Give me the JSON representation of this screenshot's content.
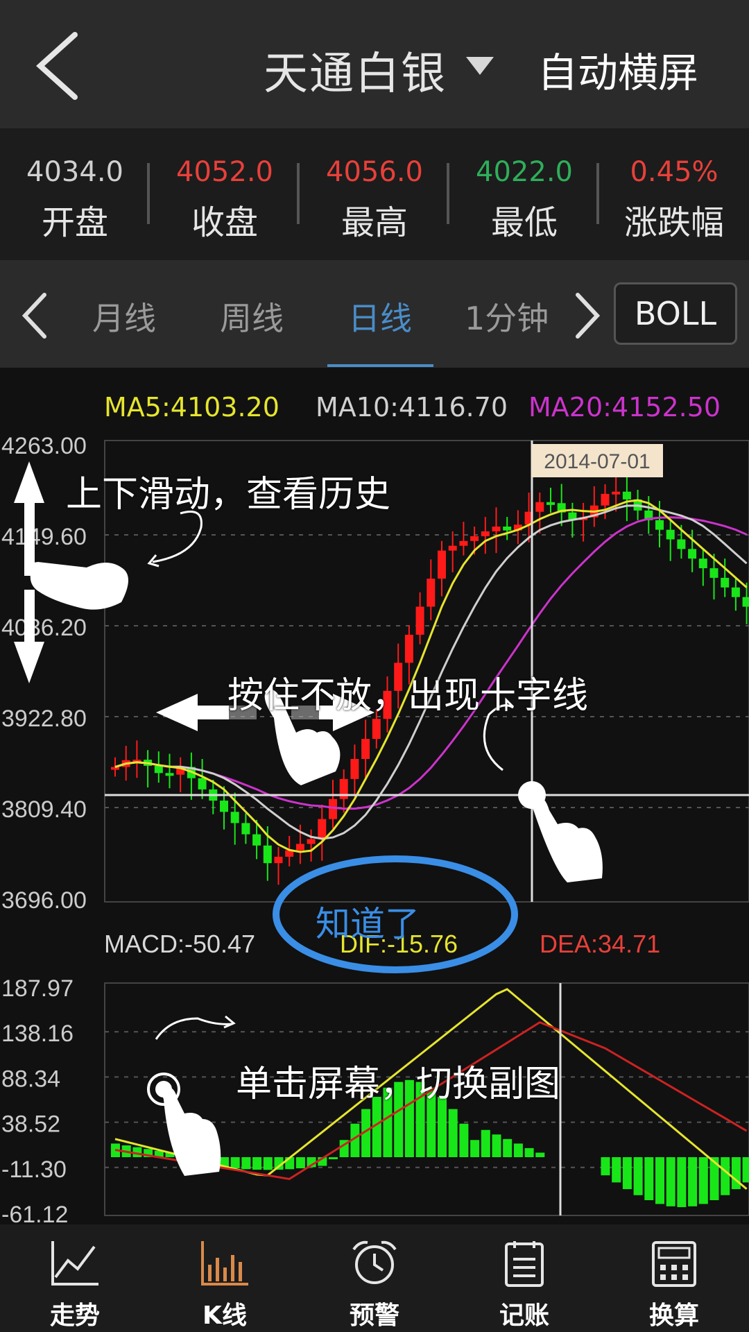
{
  "header": {
    "title": "天通白银",
    "auto_rotate": "自动横屏"
  },
  "stats": [
    {
      "value": "4034.0",
      "label": "开盘",
      "color": "#d0d0d0"
    },
    {
      "value": "4052.0",
      "label": "收盘",
      "color": "#e8403a"
    },
    {
      "value": "4056.0",
      "label": "最高",
      "color": "#e8403a"
    },
    {
      "value": "4022.0",
      "label": "最低",
      "color": "#2fae5a"
    },
    {
      "value": "0.45%",
      "label": "涨跌幅",
      "color": "#e8403a"
    }
  ],
  "periods": {
    "tabs": [
      "月线",
      "周线",
      "日线",
      "1分钟"
    ],
    "active": "日线",
    "indicator": "BOLL"
  },
  "ma_legend": {
    "ma5": "MA5:4103.20",
    "ma10": "MA10:4116.70",
    "ma20": "MA20:4152.50"
  },
  "crosshair_date": "2014-07-01",
  "macd_legend": {
    "macd": "MACD:-50.47",
    "dif": "DIF:-15.76",
    "dea": "DEA:34.71"
  },
  "price_axis": [
    "4263.00",
    "4149.60",
    "4036.20",
    "3922.80",
    "3809.40",
    "3696.00"
  ],
  "macd_axis": [
    "187.97",
    "138.16",
    "88.34",
    "38.52",
    "-11.30",
    "-61.12"
  ],
  "hints": {
    "scroll": "上下滑动，查看历史",
    "hold": "按住不放，出现十字线",
    "tap": "单击屏幕，切换副图",
    "got_it": "知道了"
  },
  "tabbar": [
    {
      "label": "走势",
      "icon": "trend-icon"
    },
    {
      "label": "K线",
      "icon": "kline-icon",
      "active": true
    },
    {
      "label": "预警",
      "icon": "alarm-clock-icon"
    },
    {
      "label": "记账",
      "icon": "ledger-icon"
    },
    {
      "label": "换算",
      "icon": "calculator-icon"
    }
  ],
  "colors": {
    "up": "#ff1a1a",
    "down": "#19e619",
    "ma5": "#e5e52e",
    "ma10": "#d0d0d0",
    "ma20": "#cc33cc",
    "accent": "#4a8dc9",
    "k_line_tab": "#d98a4a"
  }
}
